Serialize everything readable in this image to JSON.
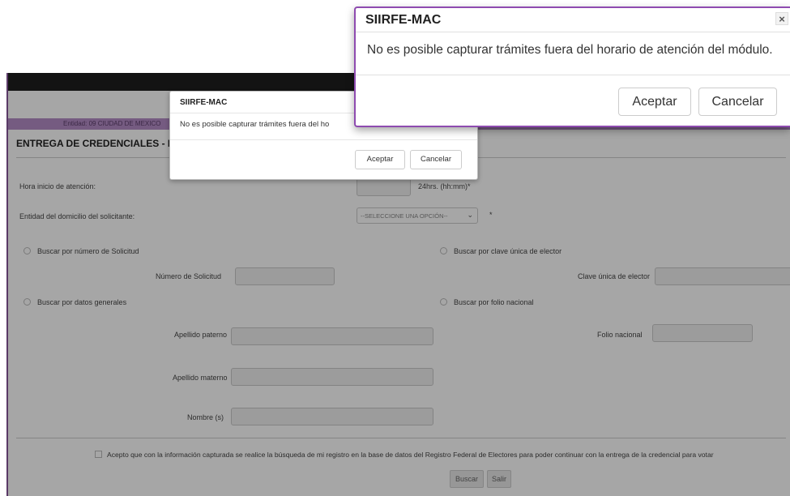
{
  "app": {
    "entity_label": "Entidad: 09 CIUDAD DE MEXICO",
    "entity_right": "",
    "page_title": "ENTREGA DE CREDENCIALES - Bu",
    "form": {
      "hora_label": "Hora inicio de atención:",
      "hora_hint": "24hrs. (hh:mm)*",
      "entidad_label": "Entidad  del domicilio del solicitante:",
      "entidad_select": "--SELECCIONE UNA OPCIÓN--",
      "entidad_required": "*",
      "radio_solicitud": "Buscar por número de Solicitud",
      "radio_clave": "Buscar por clave única de elector",
      "numero_solicitud_label": "Número de Solicitud",
      "clave_label": "Clave única de elector",
      "radio_datos": "Buscar por datos generales",
      "radio_folio": "Buscar por folio nacional",
      "apellido_paterno_label": "Apellido paterno",
      "folio_label": "Folio nacional",
      "apellido_materno_label": "Apellido materno",
      "nombre_label": "Nombre (s)",
      "consent_text": "Acepto que con la información capturada se realice la búsqueda de mi registro en la base de datos del Registro Federal de Electores para poder continuar con la entrega de la credencial para votar",
      "buscar_button": "Buscar",
      "salir_button": "Salir"
    }
  },
  "dialog_small": {
    "title": "SIIRFE-MAC",
    "message": "No es posible capturar trámites fuera del ho",
    "accept": "Aceptar",
    "cancel": "Cancelar"
  },
  "dialog_big": {
    "title": "SIIRFE-MAC",
    "close_glyph": "×",
    "message": "No es posible capturar trámites fuera del horario de atención del módulo.",
    "accept": "Aceptar",
    "cancel": "Cancelar"
  },
  "colors": {
    "accent_purple": "#8e4bb0",
    "entity_bar": "#b48cc6",
    "topbar": "#1e1e1e"
  },
  "icons": {
    "select_chevron": "chevron-down-icon",
    "close": "close-icon"
  }
}
